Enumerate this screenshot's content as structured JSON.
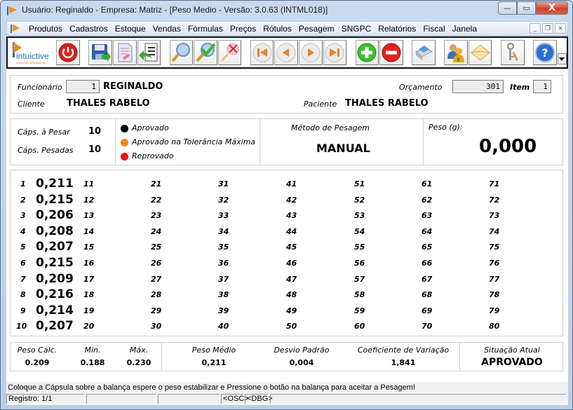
{
  "window": {
    "title": "Usuário: Reginaldo - Empresa: Matriz - [Peso Medio - Versão: 3.0.63 (INTML018)]",
    "controls": {
      "minimize": "—",
      "maximize": "▭",
      "close": "X"
    }
  },
  "menu": {
    "items": [
      "Produtos",
      "Cadastros",
      "Estoque",
      "Vendas",
      "Fórmulas",
      "Preços",
      "Rótulos",
      "Pesagem",
      "SNGPC",
      "Relatórios",
      "Fiscal",
      "Janela"
    ],
    "mdi_controls": {
      "minimize": "_",
      "restore": "❐",
      "close": "×"
    }
  },
  "toolbar": {
    "logo": {
      "text": "intuictive",
      "tagline": "soluções inteligentes"
    },
    "buttons": [
      {
        "name": "exit",
        "icon": "power-icon"
      },
      {
        "name": "save",
        "icon": "save-icon"
      },
      {
        "name": "edit",
        "icon": "edit-document-icon"
      },
      {
        "name": "return",
        "icon": "return-list-icon"
      },
      {
        "name": "search",
        "icon": "search-icon"
      },
      {
        "name": "search-confirm",
        "icon": "search-check-icon"
      },
      {
        "name": "search-clear",
        "icon": "search-clear-icon"
      },
      {
        "name": "first",
        "icon": "first-record-icon"
      },
      {
        "name": "previous",
        "icon": "previous-record-icon"
      },
      {
        "name": "next",
        "icon": "next-record-icon"
      },
      {
        "name": "last",
        "icon": "last-record-icon"
      },
      {
        "name": "add",
        "icon": "add-icon"
      },
      {
        "name": "remove",
        "icon": "remove-icon"
      },
      {
        "name": "print",
        "icon": "printer-icon"
      },
      {
        "name": "users",
        "icon": "users-icon"
      },
      {
        "name": "mail",
        "icon": "mail-icon"
      },
      {
        "name": "keys",
        "icon": "keys-icon"
      },
      {
        "name": "help",
        "icon": "help-icon"
      }
    ]
  },
  "header": {
    "funcionario_label": "Funcionário",
    "funcionario_id": "1",
    "funcionario_name": "REGINALDO",
    "cliente_label": "Cliente",
    "cliente_name": "THALES RABELO",
    "orcamento_label": "Orçamento",
    "orcamento_value": "301",
    "item_label": "Item",
    "item_value": "1",
    "paciente_label": "Paciente",
    "paciente_name": "THALES RABELO"
  },
  "info": {
    "caps_a_pesar_label": "Cáps. à Pesar",
    "caps_a_pesar_value": "10",
    "caps_pesadas_label": "Cáps. Pesadas",
    "caps_pesadas_value": "10",
    "legend": [
      {
        "label": "Aprovado",
        "color": "#000000"
      },
      {
        "label": "Aprovado na Tolerância Máxima",
        "color": "#f7861c"
      },
      {
        "label": "Reprovado",
        "color": "#ee1111"
      }
    ],
    "metodo_label": "Método de Pesagem",
    "metodo_value": "MANUAL",
    "peso_label": "Peso (g):",
    "peso_value": "0,000"
  },
  "weights": {
    "slots": [
      {
        "n": "1",
        "w": "0,211"
      },
      {
        "n": "2",
        "w": "0,215"
      },
      {
        "n": "3",
        "w": "0,206"
      },
      {
        "n": "4",
        "w": "0,208"
      },
      {
        "n": "5",
        "w": "0,207"
      },
      {
        "n": "6",
        "w": "0,215"
      },
      {
        "n": "7",
        "w": "0,209"
      },
      {
        "n": "8",
        "w": "0,216"
      },
      {
        "n": "9",
        "w": "0,214"
      },
      {
        "n": "10",
        "w": "0,207"
      },
      {
        "n": "11",
        "w": ""
      },
      {
        "n": "12",
        "w": ""
      },
      {
        "n": "13",
        "w": ""
      },
      {
        "n": "14",
        "w": ""
      },
      {
        "n": "15",
        "w": ""
      },
      {
        "n": "16",
        "w": ""
      },
      {
        "n": "17",
        "w": ""
      },
      {
        "n": "18",
        "w": ""
      },
      {
        "n": "19",
        "w": ""
      },
      {
        "n": "20",
        "w": ""
      },
      {
        "n": "21",
        "w": ""
      },
      {
        "n": "22",
        "w": ""
      },
      {
        "n": "23",
        "w": ""
      },
      {
        "n": "24",
        "w": ""
      },
      {
        "n": "25",
        "w": ""
      },
      {
        "n": "26",
        "w": ""
      },
      {
        "n": "27",
        "w": ""
      },
      {
        "n": "28",
        "w": ""
      },
      {
        "n": "29",
        "w": ""
      },
      {
        "n": "30",
        "w": ""
      },
      {
        "n": "31",
        "w": ""
      },
      {
        "n": "32",
        "w": ""
      },
      {
        "n": "33",
        "w": ""
      },
      {
        "n": "34",
        "w": ""
      },
      {
        "n": "35",
        "w": ""
      },
      {
        "n": "36",
        "w": ""
      },
      {
        "n": "37",
        "w": ""
      },
      {
        "n": "38",
        "w": ""
      },
      {
        "n": "39",
        "w": ""
      },
      {
        "n": "40",
        "w": ""
      },
      {
        "n": "41",
        "w": ""
      },
      {
        "n": "42",
        "w": ""
      },
      {
        "n": "43",
        "w": ""
      },
      {
        "n": "44",
        "w": ""
      },
      {
        "n": "45",
        "w": ""
      },
      {
        "n": "46",
        "w": ""
      },
      {
        "n": "47",
        "w": ""
      },
      {
        "n": "48",
        "w": ""
      },
      {
        "n": "49",
        "w": ""
      },
      {
        "n": "50",
        "w": ""
      },
      {
        "n": "51",
        "w": ""
      },
      {
        "n": "52",
        "w": ""
      },
      {
        "n": "53",
        "w": ""
      },
      {
        "n": "54",
        "w": ""
      },
      {
        "n": "55",
        "w": ""
      },
      {
        "n": "56",
        "w": ""
      },
      {
        "n": "57",
        "w": ""
      },
      {
        "n": "58",
        "w": ""
      },
      {
        "n": "59",
        "w": ""
      },
      {
        "n": "60",
        "w": ""
      },
      {
        "n": "61",
        "w": ""
      },
      {
        "n": "62",
        "w": ""
      },
      {
        "n": "63",
        "w": ""
      },
      {
        "n": "64",
        "w": ""
      },
      {
        "n": "65",
        "w": ""
      },
      {
        "n": "66",
        "w": ""
      },
      {
        "n": "67",
        "w": ""
      },
      {
        "n": "68",
        "w": ""
      },
      {
        "n": "69",
        "w": ""
      },
      {
        "n": "70",
        "w": ""
      },
      {
        "n": "71",
        "w": ""
      },
      {
        "n": "72",
        "w": ""
      },
      {
        "n": "73",
        "w": ""
      },
      {
        "n": "74",
        "w": ""
      },
      {
        "n": "75",
        "w": ""
      },
      {
        "n": "76",
        "w": ""
      },
      {
        "n": "77",
        "w": ""
      },
      {
        "n": "78",
        "w": ""
      },
      {
        "n": "79",
        "w": ""
      },
      {
        "n": "80",
        "w": ""
      }
    ]
  },
  "summary": {
    "peso_calc_label": "Peso Calc.",
    "peso_calc_value": "0.209",
    "min_label": "Min.",
    "min_value": "0.188",
    "max_label": "Máx.",
    "max_value": "0.230",
    "peso_medio_label": "Peso Médio",
    "peso_medio_value": "0,211",
    "desvio_label": "Desvio Padrão",
    "desvio_value": "0,004",
    "cv_label": "Coeficiente de Variação",
    "cv_value": "1,841",
    "situacao_label": "Situação Atual",
    "situacao_value": "APROVADO"
  },
  "hint": "Coloque a Cápsula sobre a balança espere o peso estabilizar e Pressione o botão na balança para aceitar a Pesagem!",
  "statusbar": {
    "registro": "Registro: 1/1",
    "cell2": "",
    "cell3": "",
    "osc": "<OSC>",
    "dbg": "<DBG>",
    "cell6": ""
  }
}
